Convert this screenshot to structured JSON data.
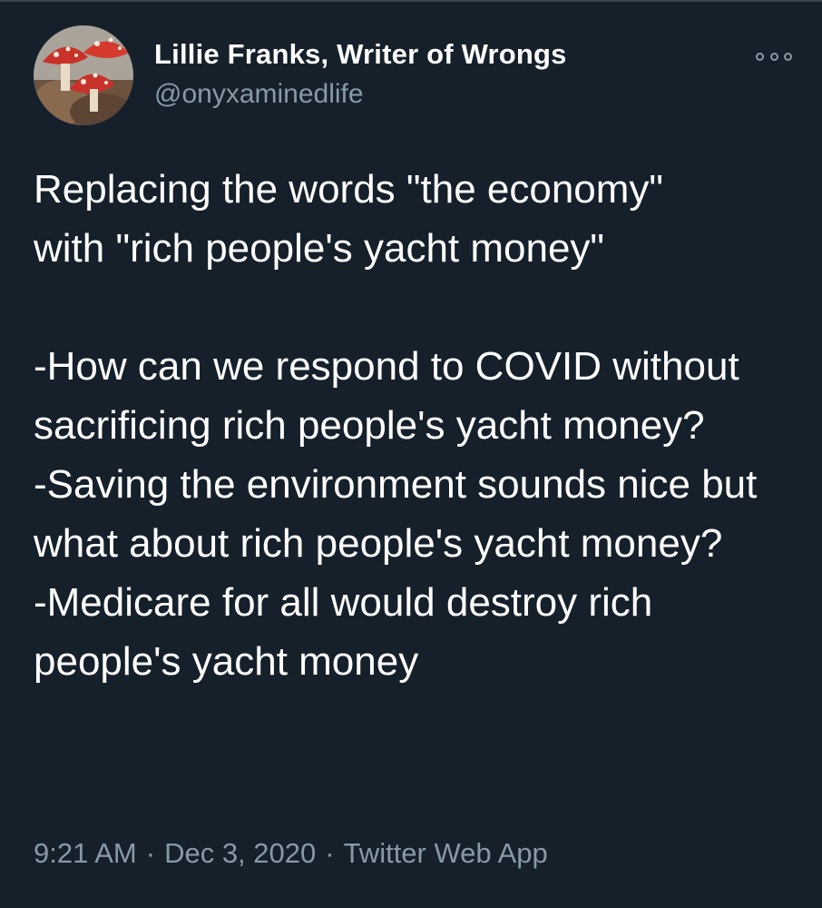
{
  "tweet": {
    "author_name": "Lillie Franks, Writer of Wrongs",
    "handle": "@onyxaminedlife",
    "text_intro": [
      "Replacing the words \"the economy\"",
      "with \"rich people's yacht money\""
    ],
    "text_items": [
      "-How can we respond to COVID without sacrificing rich people's yacht money?",
      "-Saving the environment sounds nice but what about rich people's yacht money?",
      "-Medicare for all would destroy rich people's yacht money"
    ],
    "time": "9:21 AM",
    "date": "Dec 3, 2020",
    "source": "Twitter Web App",
    "separator": "·"
  },
  "icons": {
    "more": "more-options-icon",
    "avatar": "avatar-image"
  },
  "colors": {
    "background": "#15202b",
    "text": "#ffffff",
    "muted": "#8899a6",
    "avatar_red": "#c8322a"
  }
}
